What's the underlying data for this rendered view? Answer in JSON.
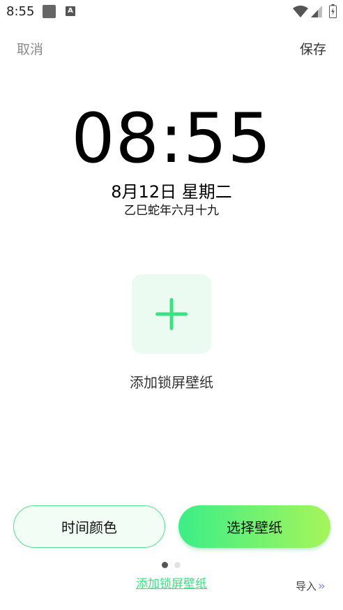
{
  "status_bar": {
    "time": "8:55",
    "app_icon_letter": "A",
    "icons": [
      "notification-square-icon",
      "app-notification-icon",
      "wifi-icon",
      "signal-icon",
      "battery-icon"
    ]
  },
  "header": {
    "cancel_label": "取消",
    "save_label": "保存"
  },
  "clock": {
    "time": "08:55",
    "date": "8月12日 星期二",
    "lunar": "乙巳蛇年六月十九"
  },
  "add_wallpaper": {
    "label": "添加锁屏壁纸",
    "icon": "plus-icon"
  },
  "buttons": {
    "time_color": "时间颜色",
    "choose_wallpaper": "选择壁纸"
  },
  "pager": {
    "page_count": 2,
    "active_index": 0
  },
  "footer": {
    "add_link": "添加锁屏壁纸",
    "import_label": "导入",
    "import_icon": "double-chevron-right-icon"
  },
  "colors": {
    "accent_green": "#3ee084",
    "tile_bg": "#ecfbf2",
    "gradient_start": "#3cee88",
    "gradient_end": "#a6f55a"
  }
}
